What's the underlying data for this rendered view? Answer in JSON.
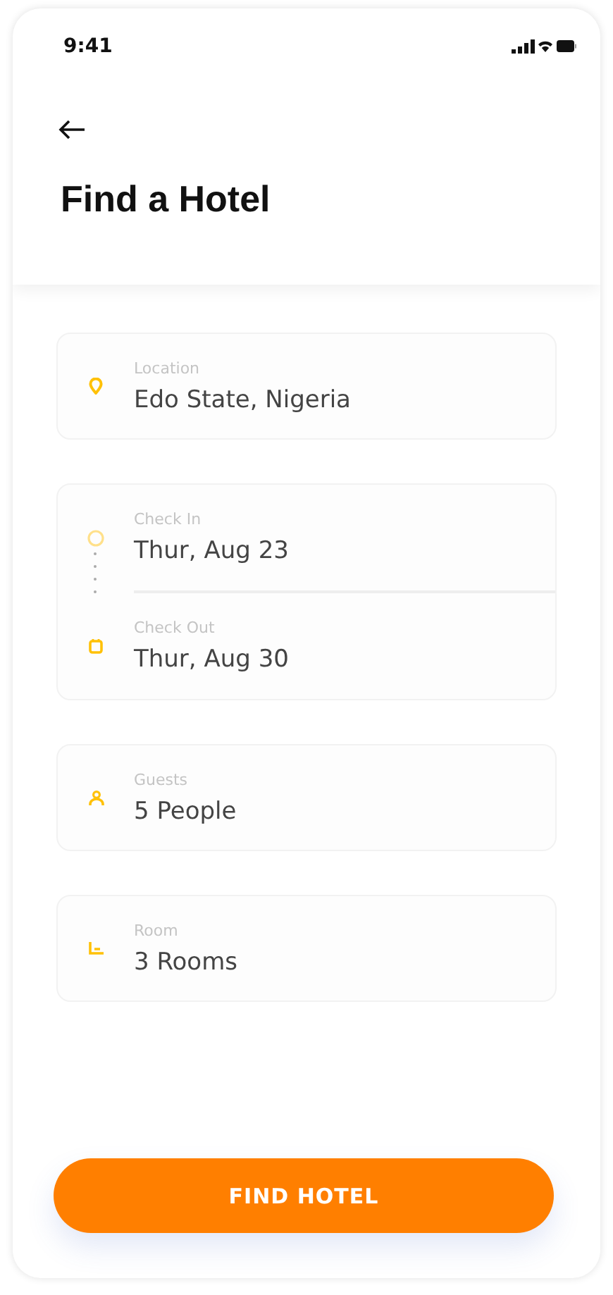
{
  "status_bar": {
    "time": "9:41"
  },
  "header": {
    "title": "Find a Hotel"
  },
  "fields": [
    {
      "kind": "location",
      "label": "Location",
      "value": "Edo State, Nigeria"
    },
    {
      "kind": "dates",
      "rows": [
        {
          "kind": "checkin",
          "label": "Check In",
          "value": "Thur, Aug 23"
        },
        {
          "kind": "checkout",
          "label": "Check Out",
          "value": "Thur, Aug 30"
        }
      ]
    },
    {
      "kind": "guests",
      "label": "Guests",
      "value": "5 People"
    },
    {
      "kind": "room",
      "label": "Room",
      "value": "3 Rooms"
    }
  ],
  "button": {
    "label": "FIND HOTEL"
  }
}
